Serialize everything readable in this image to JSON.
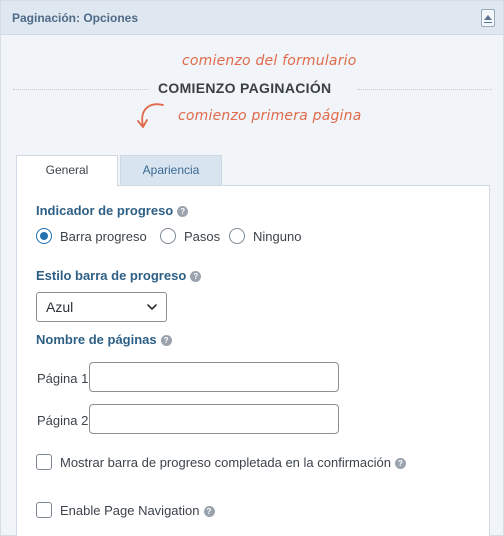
{
  "panel": {
    "title": "Paginación: Opciones"
  },
  "hints": {
    "form_start": "comienzo del formulario",
    "first_page_start": "comienzo primera página"
  },
  "divider": {
    "title": "COMIENZO PAGINACIÓN"
  },
  "tabs": [
    {
      "label": "General",
      "active": true
    },
    {
      "label": "Apariencia",
      "active": false
    }
  ],
  "progress_indicator": {
    "label": "Indicador de progreso",
    "options": [
      {
        "label": "Barra progreso",
        "checked": true
      },
      {
        "label": "Pasos",
        "checked": false
      },
      {
        "label": "Ninguno",
        "checked": false
      }
    ]
  },
  "progress_style": {
    "label": "Estilo barra de progreso",
    "selected": "Azul"
  },
  "page_names": {
    "label": "Nombre de páginas",
    "pages": [
      {
        "label": "Página 1",
        "value": ""
      },
      {
        "label": "Página 2",
        "value": ""
      }
    ]
  },
  "checkboxes": [
    {
      "label": "Mostrar barra de progreso completada en la confirmación",
      "checked": false
    },
    {
      "label": "Enable Page Navigation",
      "checked": false
    }
  ],
  "colors": {
    "accent": "#2271b1",
    "section_label": "#2d5f85",
    "hint": "#e06a4a",
    "header_bg": "#dfe7f1"
  },
  "icons": {
    "help": "help-icon",
    "collapse": "collapse-icon",
    "curved_arrow": "curved-arrow-icon",
    "chevron": "chevron-down-icon"
  }
}
